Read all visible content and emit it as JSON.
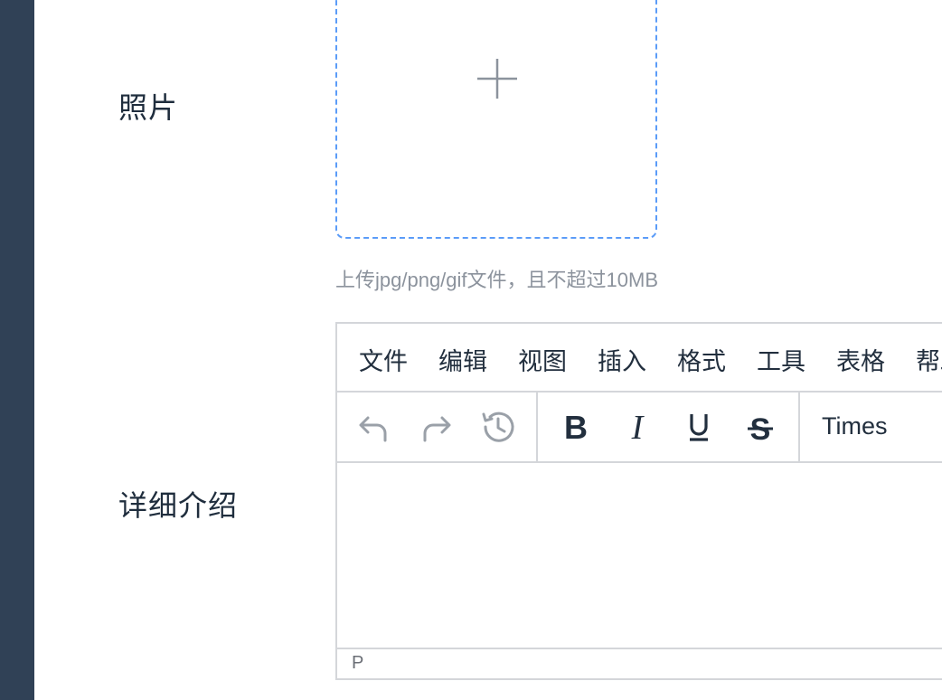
{
  "form": {
    "photo_label": "照片",
    "intro_label": "详细介绍"
  },
  "upload": {
    "icon": "plus-icon",
    "tip": "上传jpg/png/gif文件，且不超过10MB",
    "border_color": "#5b9cf8"
  },
  "editor": {
    "menu": [
      "文件",
      "编辑",
      "视图",
      "插入",
      "格式",
      "工具",
      "表格",
      "帮助"
    ],
    "toolbar": {
      "history": [
        "undo-icon",
        "redo-icon",
        "history-icon"
      ],
      "format": [
        "bold-icon",
        "italic-icon",
        "underline-icon",
        "strikethrough-icon"
      ],
      "font_family": "Times"
    },
    "status_path": "P"
  },
  "colors": {
    "sidebar": "#304156",
    "text": "#222f3e",
    "muted": "#8c939d",
    "border": "#d4d6da"
  }
}
